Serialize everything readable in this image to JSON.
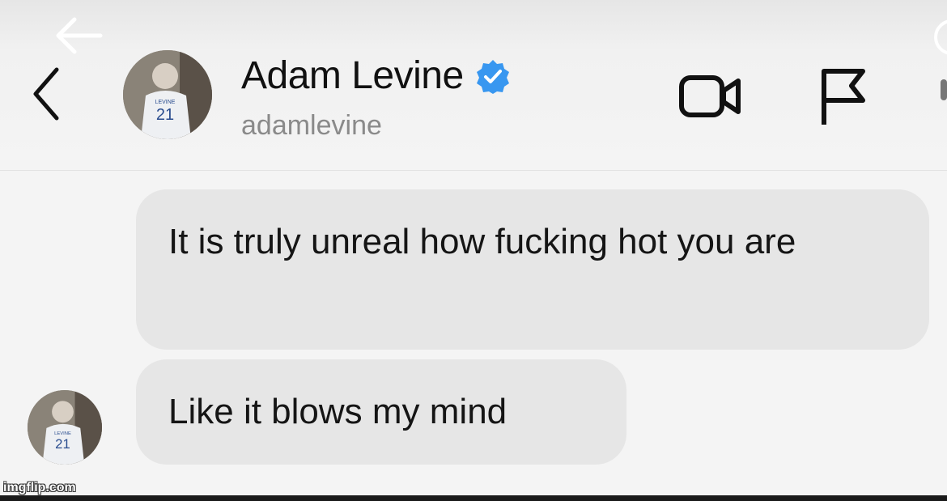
{
  "header": {
    "display_name": "Adam Levine",
    "username": "adamlevine",
    "verified": true,
    "verified_color": "#3897f0",
    "avatar_jersey_number": "21",
    "avatar_jersey_text": "LEVINE",
    "icons": [
      "back-arrow-icon",
      "back-chevron-icon",
      "video-call-icon",
      "flag-icon"
    ]
  },
  "messages": [
    {
      "text": "It is truly unreal how fucking hot you are"
    },
    {
      "text": "Like it blows my mind"
    }
  ],
  "watermark": "imgflip.com"
}
